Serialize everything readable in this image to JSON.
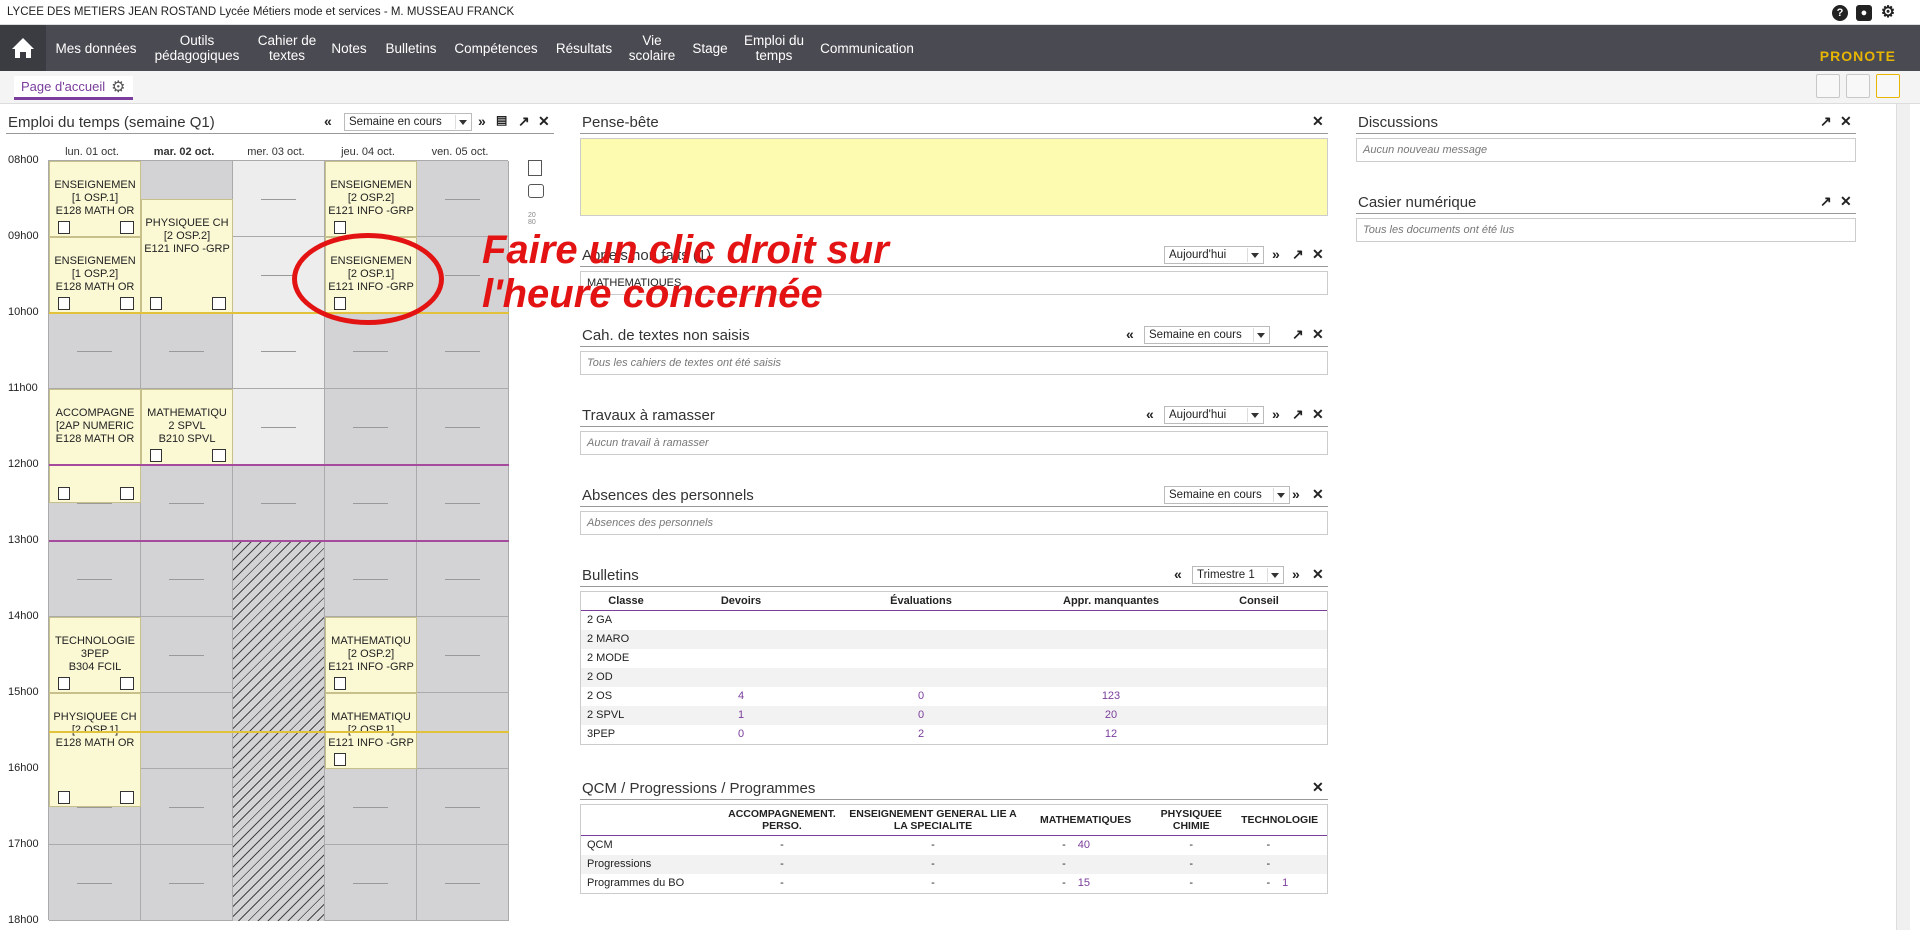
{
  "window": {
    "title": "LYCEE DES METIERS JEAN ROSTAND Lycée Métiers mode et services - M. MUSSEAU FRANCK"
  },
  "nav": {
    "items": [
      "Mes données",
      "Outils pédagogiques",
      "Cahier de textes",
      "Notes",
      "Bulletins",
      "Compétences",
      "Résultats",
      "Vie scolaire",
      "Stage",
      "Emploi du temps",
      "Communication"
    ],
    "logo": "PRONOTE"
  },
  "tabs": {
    "home": "Page d'accueil"
  },
  "timetable": {
    "title": "Emploi du temps (semaine Q1)",
    "week_select": "Semaine en cours",
    "days": [
      "lun. 01 oct.",
      "mar. 02 oct.",
      "mer. 03 oct.",
      "jeu. 04 oct.",
      "ven. 05 oct."
    ],
    "hours": [
      "08h00",
      "09h00",
      "10h00",
      "11h00",
      "12h00",
      "13h00",
      "14h00",
      "15h00",
      "16h00",
      "17h00",
      "18h00"
    ],
    "courses": [
      {
        "lines": [
          "ENSEIGNEMEN",
          "[1 OSP.1]",
          "E128 MATH OR"
        ]
      },
      {
        "lines": [
          "ENSEIGNEMEN",
          "[1 OSP.2]",
          "E128 MATH OR"
        ]
      },
      {
        "lines": [
          "PHYSIQUEE CH",
          "[2 OSP.2]",
          "E121 INFO -GRP"
        ]
      },
      {
        "lines": [
          "ENSEIGNEMEN",
          "[2 OSP.2]",
          "E121 INFO -GRP"
        ]
      },
      {
        "lines": [
          "ENSEIGNEMEN",
          "[2 OSP.1]",
          "E121 INFO -GRP"
        ]
      },
      {
        "lines": [
          "ACCOMPAGNE",
          "[2AP NUMERIC",
          "E128 MATH OR"
        ]
      },
      {
        "lines": [
          "MATHEMATIQU",
          "2 SPVL",
          "B210 SPVL"
        ]
      },
      {
        "lines": [
          "TECHNOLOGIE",
          "3PEP",
          "B304 FCIL"
        ]
      },
      {
        "lines": [
          "MATHEMATIQU",
          "[2 OSP.2]",
          "E121 INFO -GRP"
        ]
      },
      {
        "lines": [
          "PHYSIQUEE CH",
          "[2 OSP.1]",
          "E128 MATH OR"
        ]
      },
      {
        "lines": [
          "MATHEMATIQU",
          "[2 OSP.1]",
          "E121 INFO -GRP"
        ]
      }
    ]
  },
  "pense_bete": {
    "title": "Pense-bête"
  },
  "appels": {
    "title": "Appels non faits (1)",
    "select": "Aujourd'hui",
    "row": "MATHEMATIQUES"
  },
  "cahier": {
    "title": "Cah. de textes non saisis",
    "select": "Semaine en cours",
    "empty": "Tous les cahiers de textes ont été saisis"
  },
  "travaux": {
    "title": "Travaux à ramasser",
    "select": "Aujourd'hui",
    "empty": "Aucun travail à ramasser"
  },
  "absences": {
    "title": "Absences des personnels",
    "select": "Semaine en cours",
    "empty": "Absences des personnels"
  },
  "bulletins": {
    "title": "Bulletins",
    "select": "Trimestre 1",
    "headers": [
      "Classe",
      "Devoirs",
      "Évaluations",
      "Appr. manquantes",
      "Conseil"
    ],
    "rows": [
      [
        "2 GA",
        "",
        "",
        "",
        ""
      ],
      [
        "2 MARO",
        "",
        "",
        "",
        ""
      ],
      [
        "2 MODE",
        "",
        "",
        "",
        ""
      ],
      [
        "2 OD",
        "",
        "",
        "",
        ""
      ],
      [
        "2 OS",
        "4",
        "0",
        "123",
        ""
      ],
      [
        "2 SPVL",
        "1",
        "0",
        "20",
        ""
      ],
      [
        "3PEP",
        "0",
        "2",
        "12",
        ""
      ]
    ]
  },
  "qcm": {
    "title": "QCM / Progressions / Programmes",
    "headers": [
      "",
      "ACCOMPAGNEMENT. PERSO.",
      "ENSEIGNEMENT GENERAL LIE A LA SPECIALITE",
      "MATHEMATIQUES",
      "PHYSIQUEE CHIMIE",
      "TECHNOLOGIE"
    ],
    "rows": [
      [
        "QCM",
        "-",
        "-",
        "-",
        "40",
        "-",
        "-",
        ""
      ],
      [
        "Progressions",
        "-",
        "-",
        "-",
        "",
        "-",
        "-",
        ""
      ],
      [
        "Programmes du BO",
        "-",
        "-",
        "-",
        "15",
        "-",
        "-",
        "1"
      ]
    ]
  },
  "discussions": {
    "title": "Discussions",
    "empty": "Aucun nouveau message"
  },
  "casier": {
    "title": "Casier numérique",
    "empty": "Tous les documents ont été lus"
  },
  "annotation": {
    "line1": "Faire un clic droit sur",
    "line2": "l'heure concernée"
  },
  "colors": {
    "accent": "#7a3d9c",
    "annotation": "#e41313",
    "course_bg": "#fbf8d4",
    "pense_bete_bg": "#fdfbb0"
  }
}
